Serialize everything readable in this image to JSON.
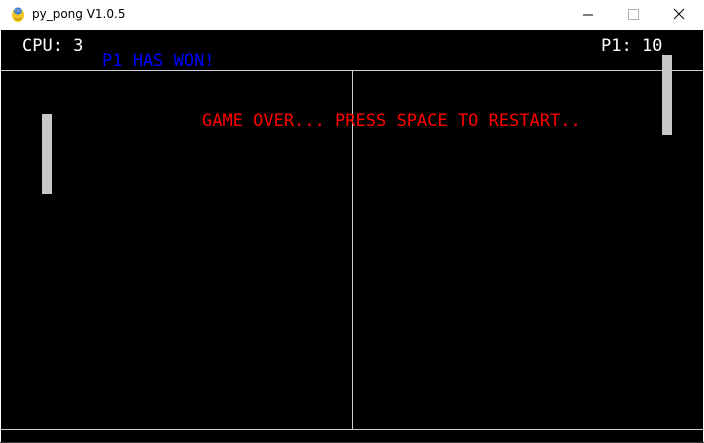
{
  "window": {
    "title": "py_pong V1.0.5",
    "icon": "python-snake-icon"
  },
  "hud": {
    "cpu_score": "CPU: 3",
    "p1_score": "P1: 10",
    "winner_message": "P1 HAS WON!",
    "game_over_message": "GAME OVER... PRESS SPACE TO RESTART.."
  },
  "colors": {
    "background": "#000000",
    "score_text": "#ffffff",
    "winner_text": "#0000ff",
    "game_over_text": "#ff0000",
    "paddle": "#c8c8c8",
    "court_lines": "#d0d0d0"
  }
}
